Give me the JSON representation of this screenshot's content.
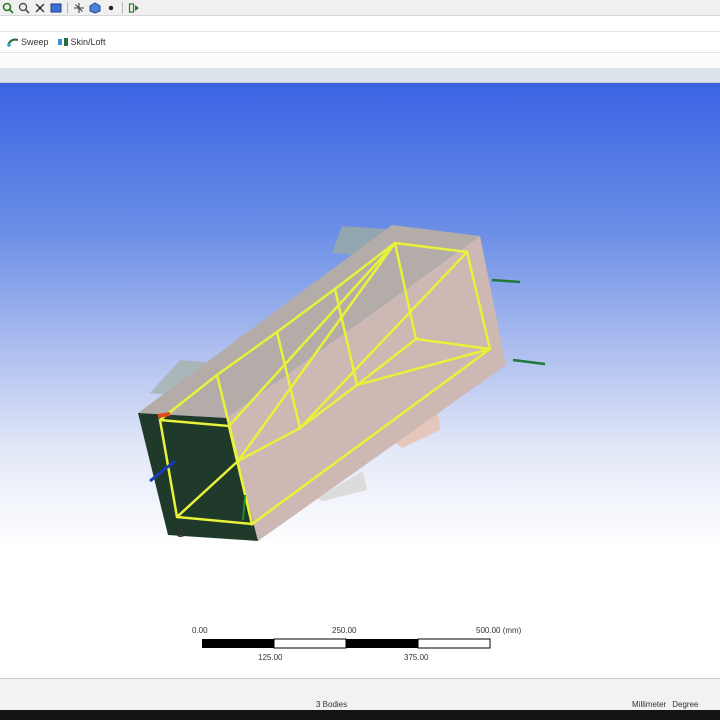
{
  "toolbar": {
    "icons": [
      "zoom-to-fit-icon",
      "zoom-box-icon",
      "select-mode-icon",
      "display-plane-icon",
      "look-at-icon",
      "display-model-icon",
      "display-point-icon",
      "toggle-icon"
    ]
  },
  "features_toolbar": {
    "sweep_label": "Sweep",
    "skin_loft_label": "Skin/Loft"
  },
  "viewport": {
    "colors": {
      "sky_top": "#3a63e3",
      "sky_bottom": "#ffffff",
      "body_fill": "#b9aca6",
      "selected_edges": "#e8f23a",
      "end_face": "#1f3a2a"
    }
  },
  "scale_bar": {
    "top_labels": [
      "0.00",
      "250.00",
      "500.00 (mm)"
    ],
    "bottom_labels": [
      "125.00",
      "375.00"
    ]
  },
  "status_bar": {
    "bodies": "3 Bodies",
    "units_length": "Millimeter",
    "units_angle": "Degree"
  }
}
